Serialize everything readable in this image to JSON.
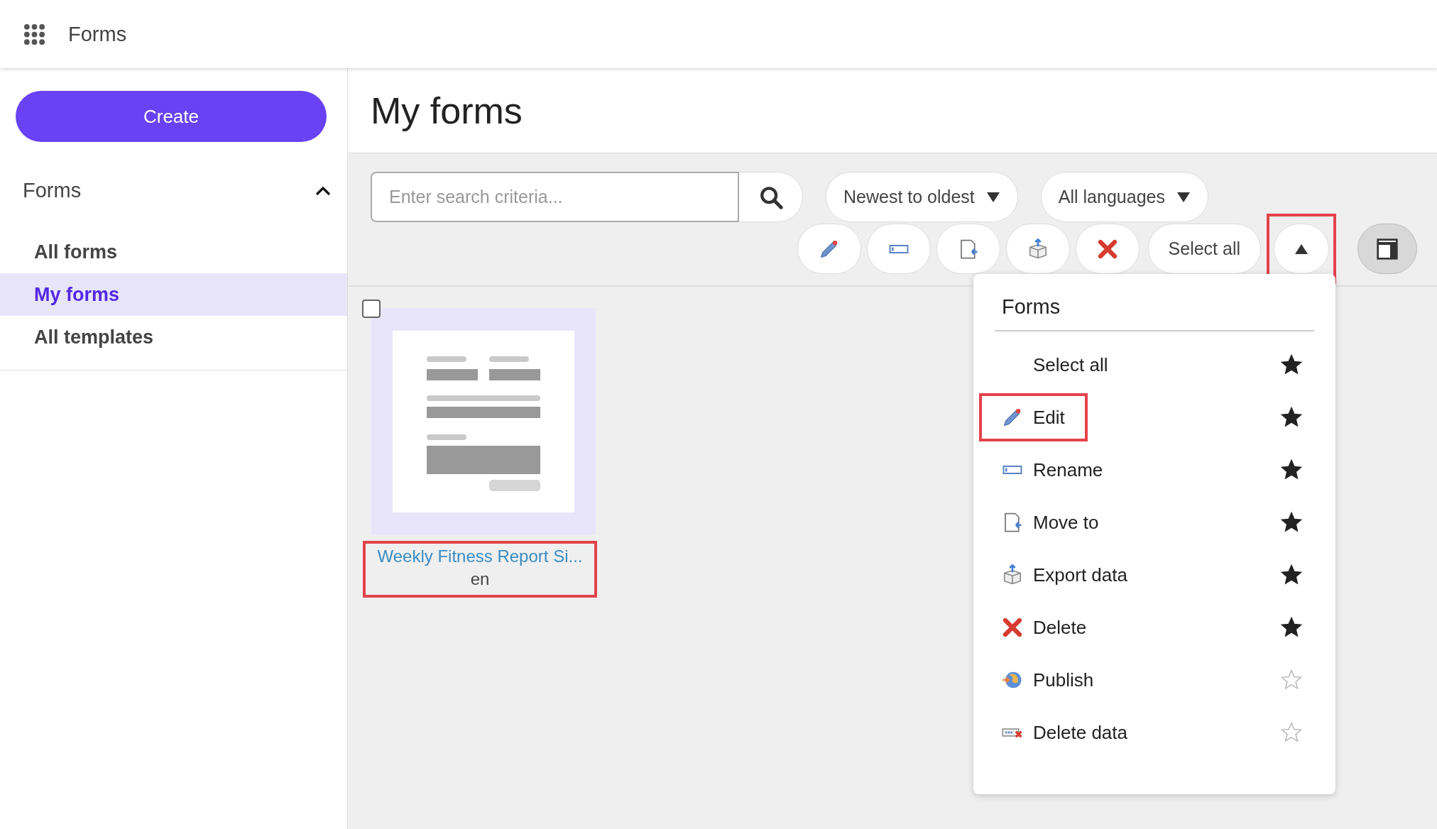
{
  "app": {
    "title": "Forms"
  },
  "sidebar": {
    "create_button": "Create",
    "section": {
      "title": "Forms",
      "expanded": true
    },
    "items": [
      {
        "label": "All forms",
        "selected": false
      },
      {
        "label": "My forms",
        "selected": true
      },
      {
        "label": "All templates",
        "selected": false
      }
    ]
  },
  "page": {
    "title": "My forms"
  },
  "toolbar": {
    "search": {
      "placeholder": "Enter search criteria..."
    },
    "sort": "Newest to oldest",
    "language": "All languages",
    "actions": [
      {
        "kind": "edit"
      },
      {
        "kind": "rename"
      },
      {
        "kind": "move"
      },
      {
        "kind": "export"
      },
      {
        "kind": "delete"
      }
    ],
    "select_all": "Select all",
    "collapse": {
      "expanded": true,
      "highlighted": true
    }
  },
  "forms": [
    {
      "title": "Weekly Fitness Report Si...",
      "language": "en",
      "checked": false,
      "highlighted": true
    }
  ],
  "menu": {
    "title": "Forms",
    "items": [
      {
        "kind": "none",
        "label": "Select all",
        "starred": true,
        "highlighted": false
      },
      {
        "kind": "edit",
        "label": "Edit",
        "starred": true,
        "highlighted": true
      },
      {
        "kind": "rename",
        "label": "Rename",
        "starred": true,
        "highlighted": false
      },
      {
        "kind": "move",
        "label": "Move to",
        "starred": true,
        "highlighted": false
      },
      {
        "kind": "export",
        "label": "Export data",
        "starred": true,
        "highlighted": false
      },
      {
        "kind": "delete",
        "label": "Delete",
        "starred": true,
        "highlighted": false
      },
      {
        "kind": "publish",
        "label": "Publish",
        "starred": false,
        "highlighted": false
      },
      {
        "kind": "delete-data",
        "label": "Delete data",
        "starred": false,
        "highlighted": false
      }
    ]
  }
}
